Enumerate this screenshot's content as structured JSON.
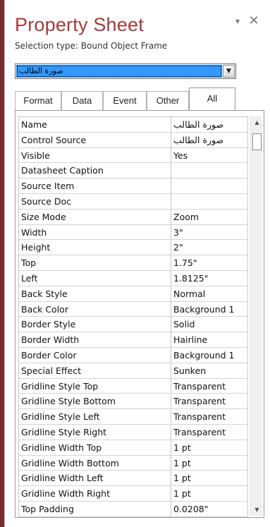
{
  "pane": {
    "title": "Property Sheet",
    "menu_glyph": "▾",
    "close_glyph": "✕",
    "selection_type": "Selection type:  Bound Object Frame",
    "selected_object": "صورة الطالب",
    "combo_arrow": "▼"
  },
  "tabs": [
    {
      "label": "Format"
    },
    {
      "label": "Data"
    },
    {
      "label": "Event"
    },
    {
      "label": "Other"
    },
    {
      "label": "All"
    }
  ],
  "active_tab": "All",
  "properties": [
    {
      "name": "Name",
      "value": "صورة الطالب"
    },
    {
      "name": "Control Source",
      "value": "صورة الطالب"
    },
    {
      "name": "Visible",
      "value": "Yes"
    },
    {
      "name": "Datasheet Caption",
      "value": ""
    },
    {
      "name": "Source Item",
      "value": ""
    },
    {
      "name": "Source Doc",
      "value": ""
    },
    {
      "name": "Size Mode",
      "value": "Zoom"
    },
    {
      "name": "Width",
      "value": "3\""
    },
    {
      "name": "Height",
      "value": "2\""
    },
    {
      "name": "Top",
      "value": "1.75\""
    },
    {
      "name": "Left",
      "value": "1.8125\""
    },
    {
      "name": "Back Style",
      "value": "Normal"
    },
    {
      "name": "Back Color",
      "value": "Background 1"
    },
    {
      "name": "Border Style",
      "value": "Solid"
    },
    {
      "name": "Border Width",
      "value": "Hairline"
    },
    {
      "name": "Border Color",
      "value": "Background 1"
    },
    {
      "name": "Special Effect",
      "value": "Sunken"
    },
    {
      "name": "Gridline Style Top",
      "value": "Transparent"
    },
    {
      "name": "Gridline Style Bottom",
      "value": "Transparent"
    },
    {
      "name": "Gridline Style Left",
      "value": "Transparent"
    },
    {
      "name": "Gridline Style Right",
      "value": "Transparent"
    },
    {
      "name": "Gridline Width Top",
      "value": "1 pt"
    },
    {
      "name": "Gridline Width Bottom",
      "value": "1 pt"
    },
    {
      "name": "Gridline Width Left",
      "value": "1 pt"
    },
    {
      "name": "Gridline Width Right",
      "value": "1 pt"
    },
    {
      "name": "Top Padding",
      "value": "0.0208\""
    }
  ],
  "scrollbar": {
    "up_glyph": "▲",
    "down_glyph": "▼"
  },
  "colors": {
    "title": "#a33a3a",
    "selection_highlight": "#3399ff",
    "window_frame": "#7a2a2c"
  }
}
